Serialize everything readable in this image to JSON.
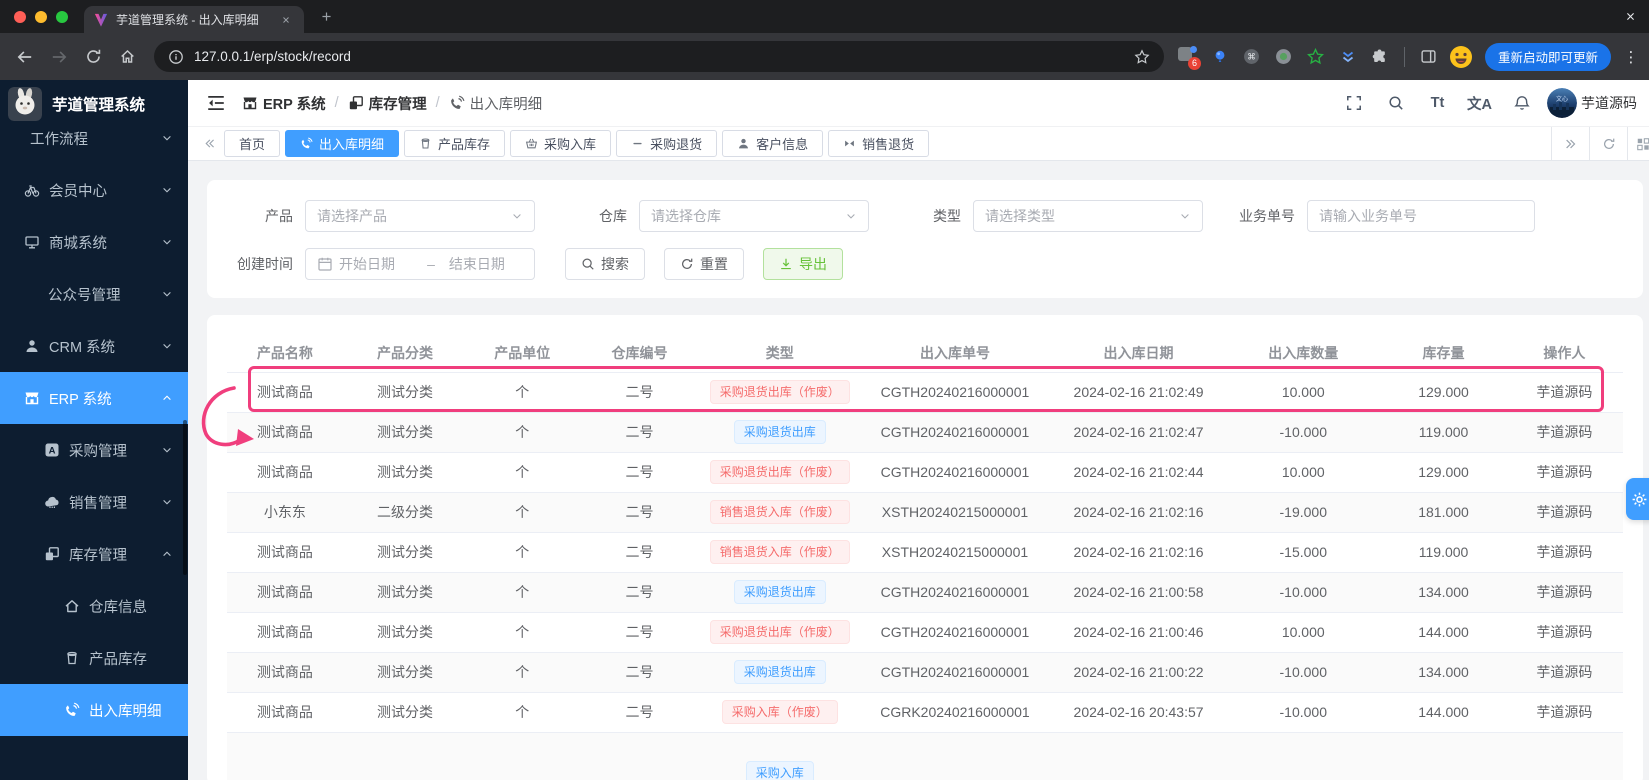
{
  "colors": {
    "accent": "#409eff",
    "annotation": "#f03e7d",
    "danger_tag": "#f56c6c",
    "primary_tag": "#409eff",
    "export_green": "#67c23a",
    "sidebar_bg": "#0d1d30"
  },
  "browser": {
    "tab_title": "芋道管理系统 - 出入库明细",
    "url": "127.0.0.1/erp/stock/record",
    "extension_badge_count": "6",
    "update_button_label": "重新启动即可更新"
  },
  "sidebar": {
    "app_title": "芋道管理系统",
    "items": [
      {
        "label": "工作流程",
        "level": 0,
        "icon": null,
        "chevron": "down",
        "active": false
      },
      {
        "label": "会员中心",
        "level": 1,
        "icon": "bicycle-icon",
        "chevron": "down",
        "active": false
      },
      {
        "label": "商城系统",
        "level": 1,
        "icon": "monitor-icon",
        "chevron": "down",
        "active": false
      },
      {
        "label": "公众号管理",
        "level": 2,
        "icon": null,
        "chevron": "down",
        "active": false
      },
      {
        "label": "CRM 系统",
        "level": 1,
        "icon": "user-icon",
        "chevron": "down",
        "active": false
      },
      {
        "label": "ERP 系统",
        "level": 1,
        "icon": "storefront-icon",
        "chevron": "up",
        "active": true
      },
      {
        "label": "采购管理",
        "level": 2,
        "icon": "letter-a-icon",
        "chevron": "down",
        "active": false
      },
      {
        "label": "销售管理",
        "level": 2,
        "icon": "cloud-icon",
        "chevron": "down",
        "active": false
      },
      {
        "label": "库存管理",
        "level": 2,
        "icon": "copy-icon",
        "chevron": "up",
        "active": false
      },
      {
        "label": "仓库信息",
        "level": 3,
        "icon": "home-icon",
        "chevron": null,
        "active": false
      },
      {
        "label": "产品库存",
        "level": 3,
        "icon": "cup-icon",
        "chevron": null,
        "active": false
      },
      {
        "label": "出入库明细",
        "level": 3,
        "icon": "phone-volume-icon",
        "chevron": null,
        "active": true
      }
    ]
  },
  "header": {
    "breadcrumb": [
      {
        "label": "ERP 系统",
        "icon": "storefront-icon"
      },
      {
        "label": "库存管理",
        "icon": "copy-icon"
      },
      {
        "label": "出入库明细",
        "icon": "phone-volume-icon"
      }
    ],
    "breadcrumb_separator": "/",
    "actions": [
      {
        "name": "fullscreen",
        "icon": "fullscreen-icon"
      },
      {
        "name": "search",
        "icon": "search-icon"
      },
      {
        "name": "font-size",
        "label": "Tt"
      },
      {
        "name": "locale",
        "label": "文A"
      },
      {
        "name": "notification",
        "icon": "bell-icon"
      }
    ],
    "username": "芋道源码"
  },
  "tabbar": {
    "tabs": [
      {
        "label": "首页",
        "icon": null,
        "active": false
      },
      {
        "label": "出入库明细",
        "icon": "phone-volume-icon",
        "active": true
      },
      {
        "label": "产品库存",
        "icon": "cup-icon",
        "active": false
      },
      {
        "label": "采购入库",
        "icon": "basket-icon",
        "active": false
      },
      {
        "label": "采购退货",
        "icon": "minus-icon",
        "active": false
      },
      {
        "label": "客户信息",
        "icon": "user-icon",
        "active": false
      },
      {
        "label": "销售退货",
        "icon": "compress-icon",
        "active": false
      }
    ]
  },
  "filters": {
    "product_label": "产品",
    "product_placeholder": "请选择产品",
    "warehouse_label": "仓库",
    "warehouse_placeholder": "请选择仓库",
    "type_label": "类型",
    "type_placeholder": "请选择类型",
    "bizno_label": "业务单号",
    "bizno_placeholder": "请输入业务单号",
    "time_label": "创建时间",
    "time_start_placeholder": "开始日期",
    "time_separator": "–",
    "time_end_placeholder": "结束日期",
    "search_label": "搜索",
    "reset_label": "重置",
    "export_label": "导出"
  },
  "table": {
    "columns": [
      "产品名称",
      "产品分类",
      "产品单位",
      "仓库编号",
      "类型",
      "出入库单号",
      "出入库日期",
      "出入库数量",
      "库存量",
      "操作人"
    ],
    "rows": [
      {
        "name": "测试商品",
        "category": "测试分类",
        "unit": "个",
        "warehouse": "二号",
        "type": "采购退货出库（作废）",
        "type_color": "red",
        "order_no": "CGTH20240216000001",
        "date": "2024-02-16 21:02:49",
        "quantity": "10.000",
        "stock": "129.000",
        "operator": "芋道源码"
      },
      {
        "name": "测试商品",
        "category": "测试分类",
        "unit": "个",
        "warehouse": "二号",
        "type": "采购退货出库",
        "type_color": "blue",
        "order_no": "CGTH20240216000001",
        "date": "2024-02-16 21:02:47",
        "quantity": "-10.000",
        "stock": "119.000",
        "operator": "芋道源码"
      },
      {
        "name": "测试商品",
        "category": "测试分类",
        "unit": "个",
        "warehouse": "二号",
        "type": "采购退货出库（作废）",
        "type_color": "red",
        "order_no": "CGTH20240216000001",
        "date": "2024-02-16 21:02:44",
        "quantity": "10.000",
        "stock": "129.000",
        "operator": "芋道源码"
      },
      {
        "name": "小东东",
        "category": "二级分类",
        "unit": "个",
        "warehouse": "二号",
        "type": "销售退货入库（作废）",
        "type_color": "red",
        "order_no": "XSTH20240215000001",
        "date": "2024-02-16 21:02:16",
        "quantity": "-19.000",
        "stock": "181.000",
        "operator": "芋道源码"
      },
      {
        "name": "测试商品",
        "category": "测试分类",
        "unit": "个",
        "warehouse": "二号",
        "type": "销售退货入库（作废）",
        "type_color": "red",
        "order_no": "XSTH20240215000001",
        "date": "2024-02-16 21:02:16",
        "quantity": "-15.000",
        "stock": "119.000",
        "operator": "芋道源码"
      },
      {
        "name": "测试商品",
        "category": "测试分类",
        "unit": "个",
        "warehouse": "二号",
        "type": "采购退货出库",
        "type_color": "blue",
        "order_no": "CGTH20240216000001",
        "date": "2024-02-16 21:00:58",
        "quantity": "-10.000",
        "stock": "134.000",
        "operator": "芋道源码"
      },
      {
        "name": "测试商品",
        "category": "测试分类",
        "unit": "个",
        "warehouse": "二号",
        "type": "采购退货出库（作废）",
        "type_color": "red",
        "order_no": "CGTH20240216000001",
        "date": "2024-02-16 21:00:46",
        "quantity": "10.000",
        "stock": "144.000",
        "operator": "芋道源码"
      },
      {
        "name": "测试商品",
        "category": "测试分类",
        "unit": "个",
        "warehouse": "二号",
        "type": "采购退货出库",
        "type_color": "blue",
        "order_no": "CGTH20240216000001",
        "date": "2024-02-16 21:00:22",
        "quantity": "-10.000",
        "stock": "134.000",
        "operator": "芋道源码"
      },
      {
        "name": "测试商品",
        "category": "测试分类",
        "unit": "个",
        "warehouse": "二号",
        "type": "采购入库（作废）",
        "type_color": "red",
        "order_no": "CGRK20240216000001",
        "date": "2024-02-16 20:43:57",
        "quantity": "-10.000",
        "stock": "144.000",
        "operator": "芋道源码"
      },
      {
        "name": "",
        "category": "",
        "unit": "",
        "warehouse": "",
        "type": "采购入库",
        "type_color": "blue",
        "order_no": "",
        "date": "",
        "quantity": "",
        "stock": "",
        "operator": "",
        "partial": true
      }
    ]
  },
  "annotation": {
    "type": "highlight-box-with-arrow",
    "color": "#f03e7d",
    "target": "first-table-row"
  }
}
